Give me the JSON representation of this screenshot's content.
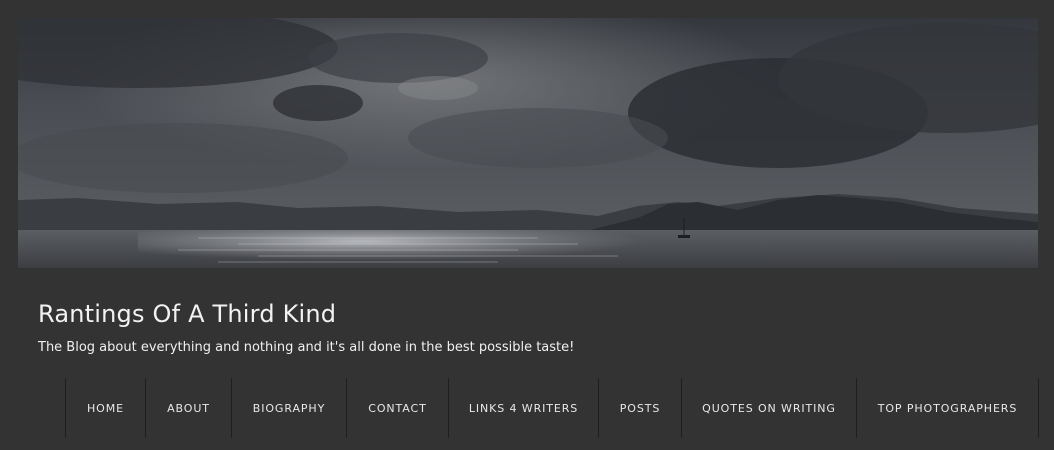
{
  "header": {
    "image": "header-image",
    "title": "Rantings Of A Third Kind",
    "tagline": "The Blog about everything and nothing and it's all done in the best possible taste!"
  },
  "nav": {
    "items": [
      {
        "label": "HOME"
      },
      {
        "label": "ABOUT"
      },
      {
        "label": "BIOGRAPHY"
      },
      {
        "label": "CONTACT"
      },
      {
        "label": "LINKS 4 WRITERS"
      },
      {
        "label": "POSTS"
      },
      {
        "label": "QUOTES ON WRITING"
      },
      {
        "label": "TOP PHOTOGRAPHERS"
      }
    ]
  },
  "colors": {
    "page_background": "#333333",
    "text": "#f2f2f2",
    "nav_divider": "#1f1f1f"
  }
}
